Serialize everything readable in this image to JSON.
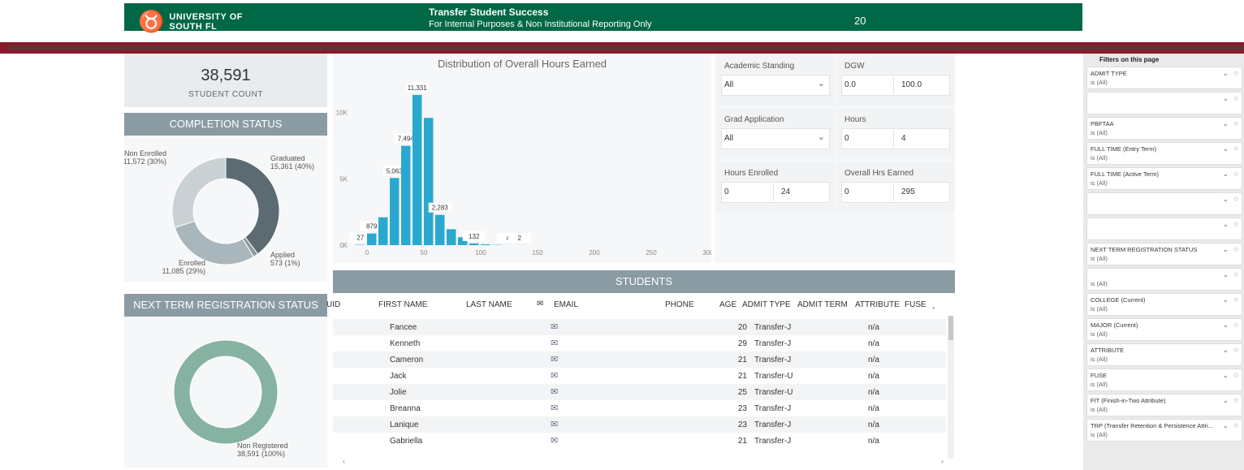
{
  "header": {
    "logo_line1": "UNIVERSITY OF",
    "logo_line2": "SOUTH FL",
    "title": "Transfer Student Success",
    "subtitle": "For Internal Purposes & Non Institutional Reporting Only",
    "year": "20"
  },
  "student_count": {
    "value": "38,591",
    "label": "STUDENT COUNT"
  },
  "completion": {
    "title": "COMPLETION STATUS",
    "segments": [
      {
        "name": "Graduated",
        "value": 15361,
        "label": "15,361 (40%)",
        "color": "#5c6b72"
      },
      {
        "name": "Applied",
        "value": 573,
        "label": "573 (1%)",
        "color": "#8d9ba2"
      },
      {
        "name": "Enrolled",
        "value": 11085,
        "label": "11,085 (29%)",
        "color": "#a9b6bc"
      },
      {
        "name": "Non Enrolled",
        "value": 11572,
        "label": "11,572 (30%)",
        "color": "#c9d1d5"
      }
    ]
  },
  "next_reg": {
    "title": "NEXT TERM REGISTRATION STATUS",
    "segments": [
      {
        "name": "Non Registered",
        "value": 38591,
        "label": "38,591 (100%)",
        "color": "#86b2a2"
      }
    ]
  },
  "chart_data": {
    "type": "bar",
    "title": "Distribution of Overall Hours Earned",
    "x": [
      0,
      10,
      20,
      30,
      40,
      50,
      60,
      70,
      80,
      90,
      100,
      110,
      120,
      130,
      140
    ],
    "values": [
      27,
      879,
      2100,
      5063,
      7494,
      11331,
      9600,
      2283,
      1200,
      600,
      132,
      60,
      20,
      4,
      2
    ],
    "labels": [
      "27",
      "879",
      "",
      "5,063",
      "7,494",
      "11,331",
      "",
      "2,283",
      "",
      "",
      "132",
      "",
      "",
      "4",
      "2"
    ],
    "y_ticks": [
      "0K",
      "5K",
      "10K"
    ],
    "x_ticks": [
      "0",
      "50",
      "100",
      "150",
      "200",
      "250",
      "300"
    ],
    "xlim": [
      0,
      300
    ],
    "ylim": [
      0,
      12000
    ],
    "bar_color": "#2aa8d0"
  },
  "slicers": [
    {
      "label": "Academic Standing",
      "value": "All"
    },
    {
      "label": "DGW",
      "min": "0.0",
      "max": "100.0"
    },
    {
      "label": "Grad Application",
      "value": "All"
    },
    {
      "label": "Hours",
      "min": "0",
      "max": "4"
    },
    {
      "label": "Hours Enrolled",
      "min": "0",
      "max": "24"
    },
    {
      "label": "Overall Hrs Earned",
      "min": "0",
      "max": "295"
    }
  ],
  "table": {
    "title": "STUDENTS",
    "columns": [
      "UID",
      "FIRST NAME",
      "LAST NAME",
      "EMAIL",
      "PHONE",
      "AGE",
      "ADMIT TYPE",
      "ADMIT TERM",
      "ATTRIBUTE",
      "FUSE"
    ],
    "rows": [
      {
        "first": "Fancee",
        "age": "20",
        "admit_type": "Transfer-J",
        "attribute": "n/a"
      },
      {
        "first": "Kenneth",
        "age": "29",
        "admit_type": "Transfer-J",
        "attribute": "n/a"
      },
      {
        "first": "Cameron",
        "age": "21",
        "admit_type": "Transfer-J",
        "attribute": "n/a"
      },
      {
        "first": "Jack",
        "age": "21",
        "admit_type": "Transfer-U",
        "attribute": "n/a"
      },
      {
        "first": "Jolie",
        "age": "25",
        "admit_type": "Transfer-U",
        "attribute": "n/a"
      },
      {
        "first": "Breanna",
        "age": "23",
        "admit_type": "Transfer-J",
        "attribute": "n/a"
      },
      {
        "first": "Lanique",
        "age": "23",
        "admit_type": "Transfer-J",
        "attribute": "n/a"
      },
      {
        "first": "Gabriella",
        "age": "21",
        "admit_type": "Transfer-J",
        "attribute": "n/a"
      }
    ]
  },
  "filters": {
    "title": "Filters on this page",
    "items": [
      {
        "name": "ADMIT TYPE",
        "value": "is (All)"
      },
      {
        "name": "",
        "value": ""
      },
      {
        "name": "PBFTAA",
        "value": "is (All)"
      },
      {
        "name": "FULL TIME (Entry Term)",
        "value": "is (All)"
      },
      {
        "name": "FULL TIME (Active Term)",
        "value": "is (All)"
      },
      {
        "name": "",
        "value": ""
      },
      {
        "name": "",
        "value": ""
      },
      {
        "name": "NEXT TERM REGISTRATION STATUS",
        "value": "is (All)"
      },
      {
        "name": "",
        "value": "is (All)"
      },
      {
        "name": "COLLEGE (Current)",
        "value": "is (All)"
      },
      {
        "name": "MAJOR (Current)",
        "value": "is (All)"
      },
      {
        "name": "ATTRIBUTE",
        "value": "is (All)"
      },
      {
        "name": "FUSE",
        "value": "is (All)"
      },
      {
        "name": "FIT (Finish-in-Two Attribute)",
        "value": "is (All)"
      },
      {
        "name": "TRP (Transfer Retention & Persistence Attri...",
        "value": "is (All)"
      }
    ]
  }
}
